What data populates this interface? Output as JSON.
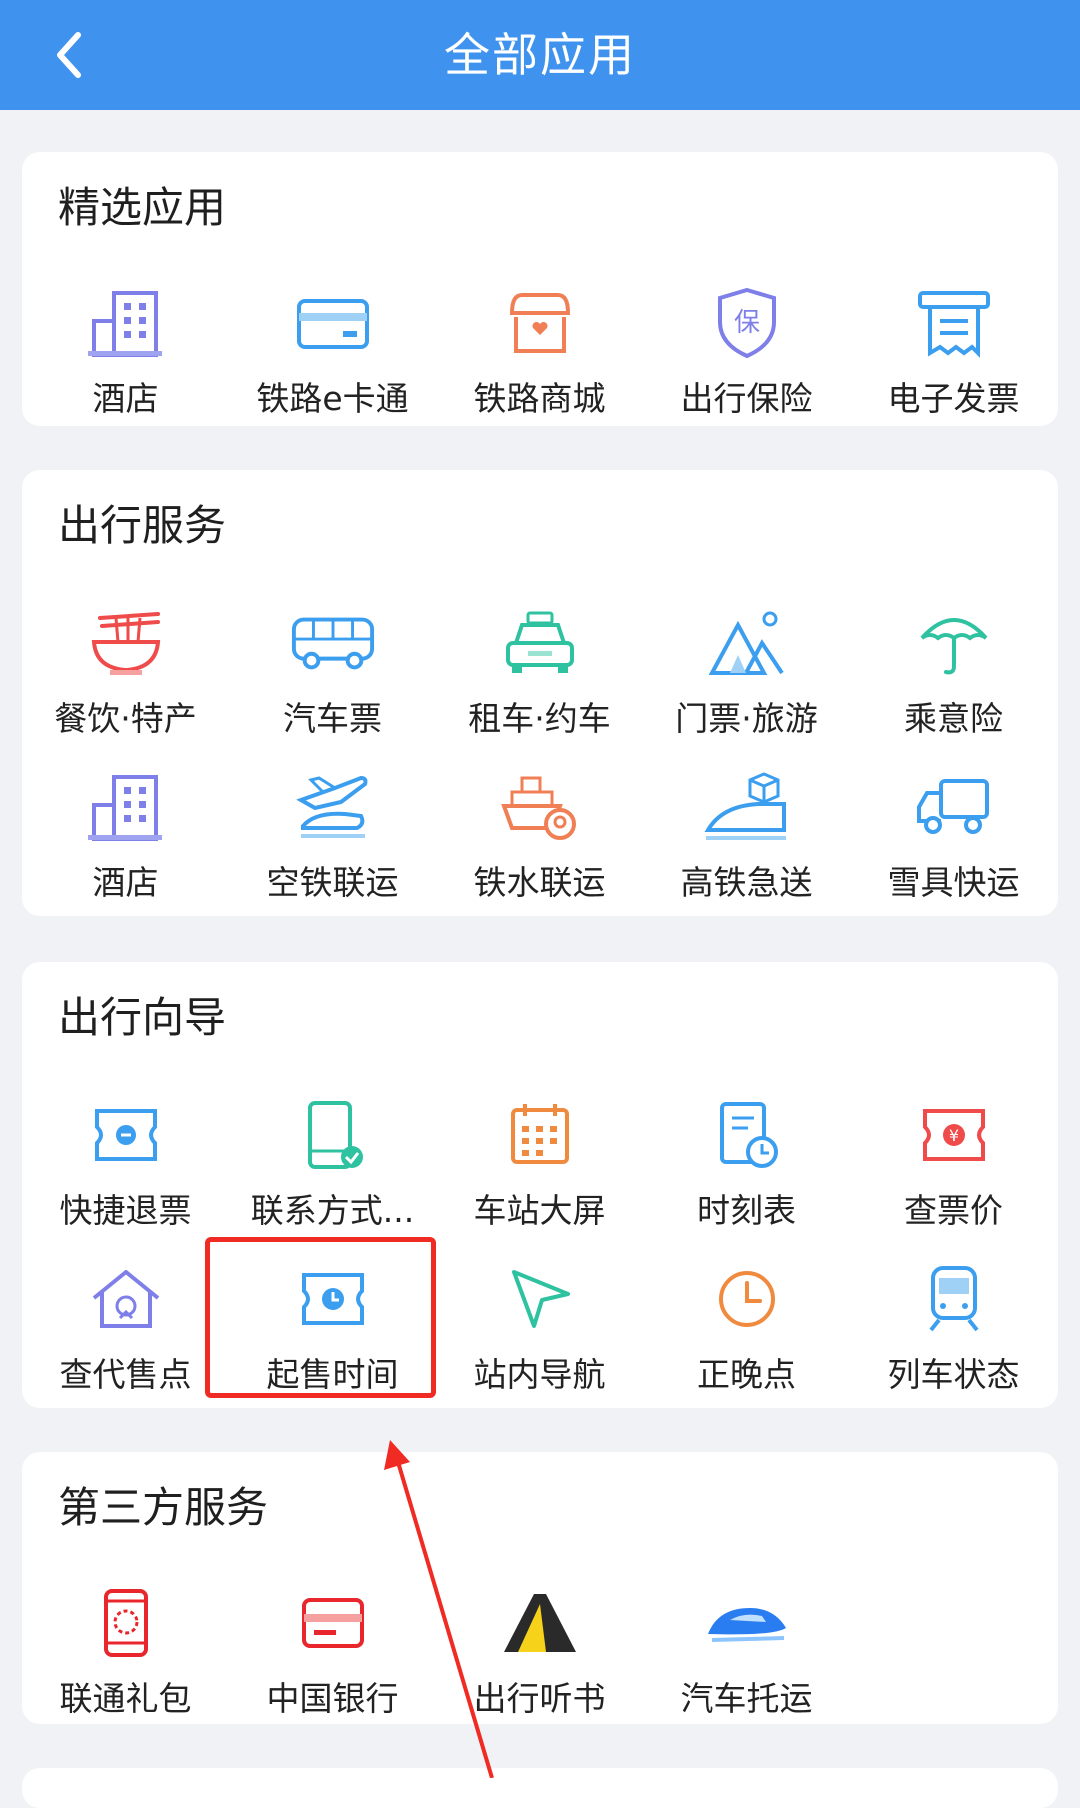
{
  "header": {
    "title": "全部应用",
    "back_icon": "back-arrow-icon"
  },
  "sections": [
    {
      "title": "精选应用",
      "items": [
        {
          "label": "酒店",
          "icon": "hotel-icon"
        },
        {
          "label": "铁路e卡通",
          "icon": "card-icon"
        },
        {
          "label": "铁路商城",
          "icon": "shop-icon"
        },
        {
          "label": "出行保险",
          "icon": "insurance-shield-icon"
        },
        {
          "label": "电子发票",
          "icon": "invoice-icon"
        }
      ]
    },
    {
      "title": "出行服务",
      "items": [
        {
          "label": "餐饮·特产",
          "icon": "noodle-bowl-icon"
        },
        {
          "label": "汽车票",
          "icon": "bus-icon"
        },
        {
          "label": "租车·约车",
          "icon": "taxi-icon"
        },
        {
          "label": "门票·旅游",
          "icon": "mountain-icon"
        },
        {
          "label": "乘意险",
          "icon": "umbrella-icon"
        },
        {
          "label": "酒店",
          "icon": "hotel-icon"
        },
        {
          "label": "空铁联运",
          "icon": "plane-train-icon"
        },
        {
          "label": "铁水联运",
          "icon": "ship-rail-icon"
        },
        {
          "label": "高铁急送",
          "icon": "train-parcel-icon"
        },
        {
          "label": "雪具快运",
          "icon": "truck-icon"
        }
      ]
    },
    {
      "title": "出行向导",
      "items": [
        {
          "label": "快捷退票",
          "icon": "refund-ticket-icon"
        },
        {
          "label": "联系方式...",
          "icon": "contact-phone-icon"
        },
        {
          "label": "车站大屏",
          "icon": "station-screen-icon"
        },
        {
          "label": "时刻表",
          "icon": "timetable-icon"
        },
        {
          "label": "查票价",
          "icon": "ticket-price-icon"
        },
        {
          "label": "查代售点",
          "icon": "agency-house-icon"
        },
        {
          "label": "起售时间",
          "icon": "sale-time-ticket-icon"
        },
        {
          "label": "站内导航",
          "icon": "navigation-icon"
        },
        {
          "label": "正晚点",
          "icon": "clock-icon"
        },
        {
          "label": "列车状态",
          "icon": "train-status-icon"
        }
      ]
    },
    {
      "title": "第三方服务",
      "items": [
        {
          "label": "联通礼包",
          "icon": "unicom-phone-icon"
        },
        {
          "label": "中国银行",
          "icon": "bank-card-icon"
        },
        {
          "label": "出行听书",
          "icon": "audiobook-icon"
        },
        {
          "label": "汽车托运",
          "icon": "car-shipping-icon"
        }
      ]
    }
  ],
  "colors": {
    "header_bg": "#3f93ef",
    "page_bg": "#f1f2f6",
    "highlight": "#f02b23"
  }
}
